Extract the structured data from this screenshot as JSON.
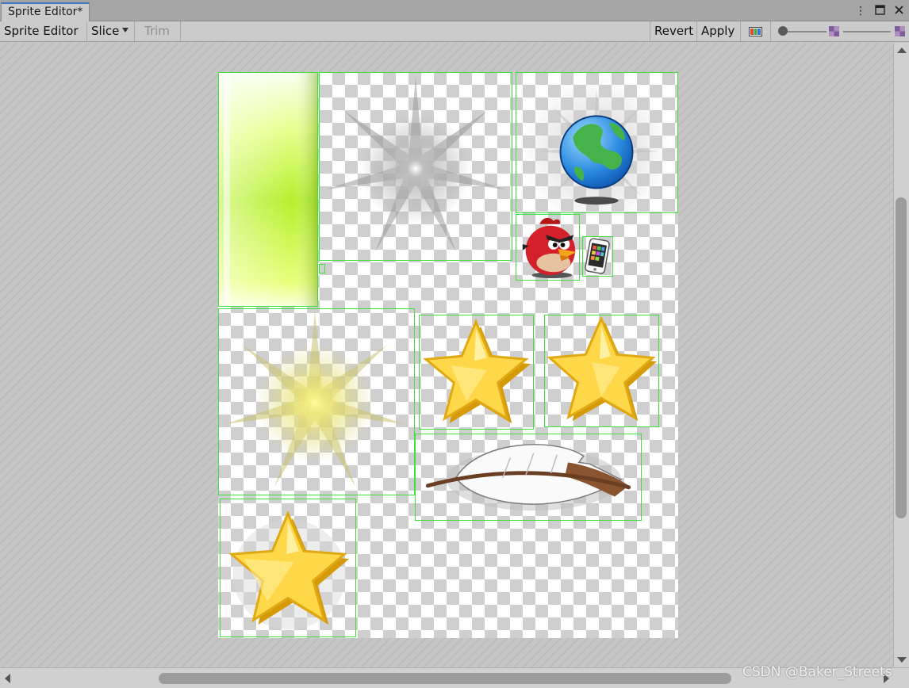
{
  "window": {
    "tab_title": "Sprite Editor*",
    "menu_icon": "kebab-icon",
    "maximize_icon": "maximize-icon",
    "close_icon": "close-icon"
  },
  "toolbar": {
    "mode_dropdown": "Sprite Editor",
    "slice_dropdown": "Slice",
    "trim_label": "Trim",
    "revert_label": "Revert",
    "apply_label": "Apply",
    "channel_icon": "rgb-channel-icon",
    "mip_slider_icon": "checker-small-icon",
    "zoom_slider_icon": "checker-large-icon"
  },
  "sprites": [
    {
      "name": "green-bar",
      "kind": "gradient-bar"
    },
    {
      "name": "white-glow",
      "kind": "glow"
    },
    {
      "name": "earth",
      "kind": "globe"
    },
    {
      "name": "red-bird",
      "kind": "bird"
    },
    {
      "name": "phone",
      "kind": "phone"
    },
    {
      "name": "small-dot",
      "kind": "dot"
    },
    {
      "name": "yellow-glow",
      "kind": "glow"
    },
    {
      "name": "star-a",
      "kind": "star"
    },
    {
      "name": "star-b",
      "kind": "star"
    },
    {
      "name": "feather",
      "kind": "feather"
    },
    {
      "name": "star-c",
      "kind": "star"
    }
  ],
  "colors": {
    "selection_outline": "#3ee03e",
    "tab_accent": "#3a79bb"
  },
  "footer": {
    "watermark": "CSDN @Baker_Streets"
  }
}
